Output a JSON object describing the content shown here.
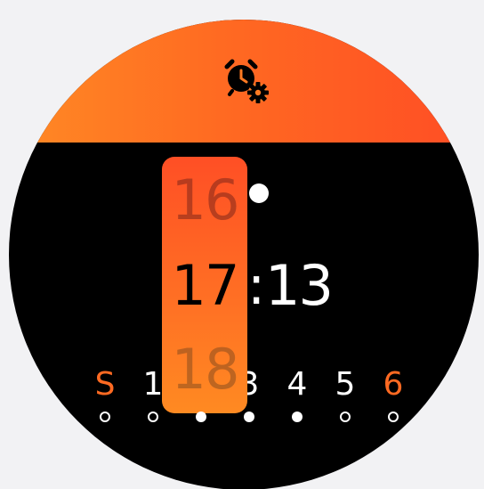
{
  "header": {
    "icon": "alarm-clock-gear-icon"
  },
  "time_picker": {
    "hour_previous": "16",
    "hour_current": "17",
    "hour_next": "18",
    "separator": ":",
    "minute": "13"
  },
  "weekdays": [
    {
      "label": "S",
      "selected": false
    },
    {
      "label": "1",
      "selected": false
    },
    {
      "label": "2",
      "selected": true
    },
    {
      "label": "3",
      "selected": true
    },
    {
      "label": "4",
      "selected": true
    },
    {
      "label": "5",
      "selected": false
    },
    {
      "label": "6",
      "selected": false
    }
  ],
  "colors": {
    "accent": "#ff6a22",
    "banner_left": "#ff8a24",
    "banner_right": "#ff4d24",
    "face": "#000000",
    "text": "#ffffff"
  }
}
